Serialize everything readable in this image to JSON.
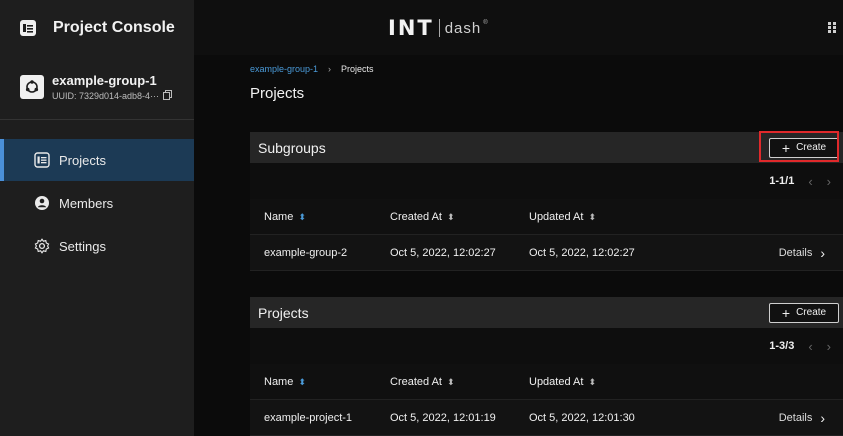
{
  "app": {
    "title": "Project Console",
    "brand_int": "INT",
    "brand_dash": "dash",
    "brand_reg": "®"
  },
  "group": {
    "name": "example-group-1",
    "uuid": "UUID: 7329d014-adb8-4···"
  },
  "nav": {
    "items": [
      {
        "label": "Projects",
        "icon": "projects-icon",
        "active": true
      },
      {
        "label": "Members",
        "icon": "members-icon",
        "active": false
      },
      {
        "label": "Settings",
        "icon": "settings-icon",
        "active": false
      }
    ]
  },
  "breadcrumb": {
    "parent": "example-group-1",
    "separator": "›",
    "current": "Projects"
  },
  "page": {
    "title": "Projects"
  },
  "columns": {
    "name": "Name",
    "created": "Created At",
    "updated": "Updated At"
  },
  "subgroups": {
    "title": "Subgroups",
    "create_label": "Create",
    "pager": "1-1/1",
    "rows": [
      {
        "name": "example-group-2",
        "created": "Oct 5, 2022, 12:02:27",
        "updated": "Oct 5, 2022, 12:02:27",
        "action": "Details"
      }
    ]
  },
  "projects": {
    "title": "Projects",
    "create_label": "Create",
    "pager": "1-3/3",
    "rows": [
      {
        "name": "example-project-1",
        "created": "Oct 5, 2022, 12:01:19",
        "updated": "Oct 5, 2022, 12:01:30",
        "action": "Details"
      }
    ]
  },
  "colors": {
    "accent": "#4a9ad8",
    "active_nav": "#1c3a55",
    "highlight": "#e0292b"
  }
}
